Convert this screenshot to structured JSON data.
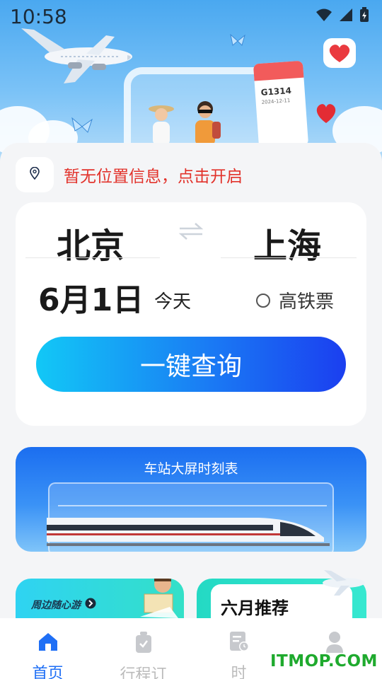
{
  "status_bar": {
    "time": "10:58"
  },
  "hero": {
    "ticket_code": "G1314",
    "ticket_date": "2024-12-11"
  },
  "location": {
    "text": "暂无位置信息，点击开启"
  },
  "search": {
    "from_city": "北京",
    "to_city": "上海",
    "date": "6月1日",
    "date_note": "今天",
    "high_speed_label": "高铁票",
    "query_button": "一键查询"
  },
  "banner": {
    "title": "车站大屏时刻表"
  },
  "cards": {
    "left_label": "周边随心游",
    "right_title": "六月推荐"
  },
  "nav": {
    "items": [
      {
        "label": "首页",
        "icon": "home-icon",
        "active": true
      },
      {
        "label": "行程订",
        "icon": "suitcase-icon",
        "active": false
      },
      {
        "label": "时",
        "icon": "timetable-icon",
        "active": false
      },
      {
        "label": "",
        "icon": "user-icon",
        "active": false
      }
    ]
  },
  "watermark": "ITMOP.COM",
  "colors": {
    "accent": "#1f6ff5",
    "location_text": "#e2322b",
    "button_start": "#12c8f6",
    "button_end": "#1b3ff0"
  }
}
